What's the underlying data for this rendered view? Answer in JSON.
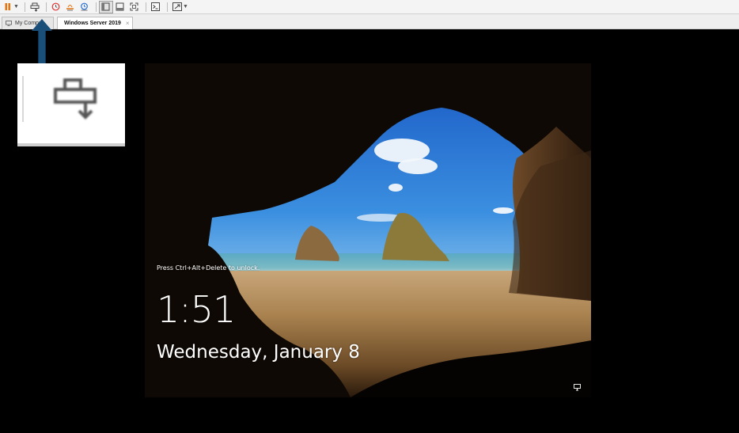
{
  "toolbar": {
    "items": [
      "pause-icon",
      "send-ctrl-alt-del-icon",
      "snapshot-icon",
      "revert-snapshot-icon",
      "snapshot-manager-icon",
      "sidebar-view-icon",
      "thumbnail-view-icon",
      "full-screen-icon",
      "console-view-icon",
      "stretch-guest-icon"
    ]
  },
  "tabs": [
    {
      "label": "My Compu"
    },
    {
      "label": "Windows Server 2019",
      "close": "×"
    }
  ],
  "lockscreen": {
    "unlock_hint": "Press Ctrl+Alt+Delete to unlock.",
    "time": "1:51",
    "date": "Wednesday, January 8"
  },
  "colors": {
    "arrow": "#1a4f7a",
    "pause": "#e8730c",
    "toolbar_bg": "#f4f4f4"
  }
}
